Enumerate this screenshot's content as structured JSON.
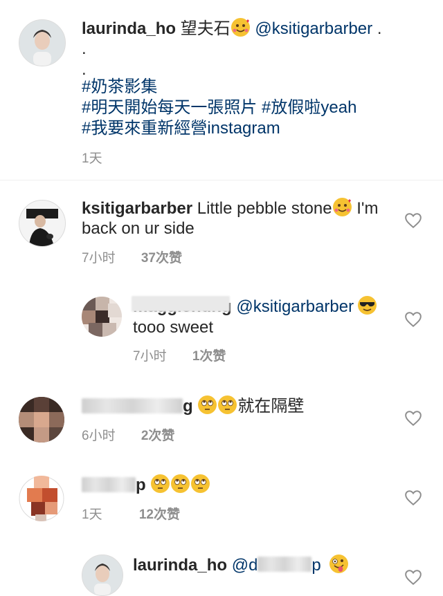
{
  "caption": {
    "username": "laurinda_ho",
    "text_main": "望夫石",
    "mention": "@ksitigarbarber",
    "trailing": ".",
    "dot1": ".",
    "dot2": ".",
    "tag1": "#奶茶影集",
    "tag2": "#明天開始每天一張照片",
    "tag3": "#放假啦yeah",
    "tag4": "#我要來重新經營instagram",
    "time": "1天"
  },
  "comments": [
    {
      "username": "ksitigarbarber",
      "text": "Little pebble stone",
      "text_after": " I'm",
      "text_line2": "back on ur side",
      "time": "7小时",
      "likes": "37次赞"
    },
    {
      "username_visible": "maggienung",
      "mention": "@ksitigarbarber",
      "text_line2": "tooo sweet",
      "time": "7小时",
      "likes": "1次赞"
    },
    {
      "username_visible": "g",
      "text": "就在隔壁",
      "time": "6小时",
      "likes": "2次赞"
    },
    {
      "username_visible": "p",
      "time": "1天",
      "likes": "12次赞"
    },
    {
      "username": "laurinda_ho",
      "mention_start": "@d",
      "mention_end": "p"
    }
  ],
  "icons": {
    "like": "heart-outline-icon",
    "emoji_love": "smiling-face-with-hearts-emoji",
    "emoji_roll": "face-with-rolling-eyes-emoji",
    "emoji_cool": "smiling-face-with-sunglasses-emoji",
    "emoji_tongue": "zany-face-emoji"
  },
  "colors": {
    "username": "#262626",
    "link": "#003569",
    "meta": "#8e8e8e",
    "divider": "#efefef"
  }
}
